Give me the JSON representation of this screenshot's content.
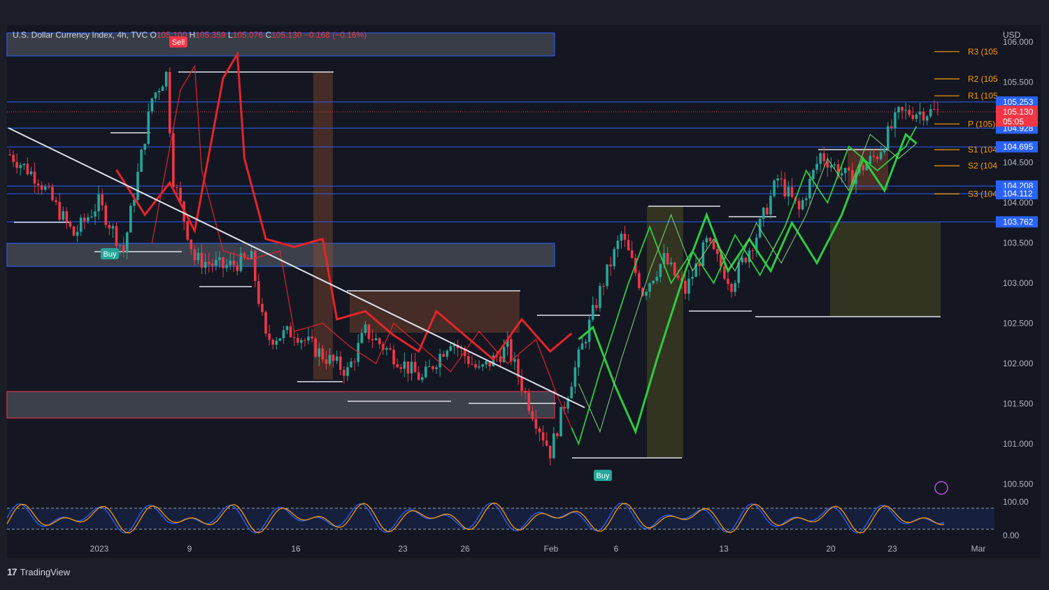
{
  "header": {
    "symbol": "U.S. Dollar Currency Index, 4h, TVC",
    "o_label": "O",
    "o_value": "105.100",
    "h_label": "H",
    "h_value": "105.359",
    "l_label": "L",
    "l_value": "105.076",
    "c_label": "C",
    "c_value": "105.130",
    "change": "−0.168 (−0.16%)"
  },
  "currency": "USD",
  "brand": "TradingView",
  "colors": {
    "up": "#26a69a",
    "down": "#f23645",
    "blue": "#2962ff",
    "pivot": "#ff9800",
    "green_ma": "#2ecc40",
    "red_ma": "#e5242a"
  },
  "chart_data": {
    "type": "candlestick",
    "title": "U.S. Dollar Currency Index, 4h, TVC",
    "ylim": [
      100.3,
      106.2
    ],
    "y_ticks": [
      "106.000",
      "105.500",
      "105.000",
      "104.500",
      "104.000",
      "103.500",
      "103.000",
      "102.500",
      "102.000",
      "101.500",
      "101.000",
      "100.500"
    ],
    "x_ticks": [
      "2023",
      "9",
      "16",
      "23",
      "26",
      "Feb",
      "6",
      "13",
      "20",
      "23",
      "Mar"
    ],
    "close_path": [
      [
        0,
        104.6
      ],
      [
        8,
        104.3
      ],
      [
        18,
        103.6
      ],
      [
        25,
        104.0
      ],
      [
        32,
        103.4
      ],
      [
        40,
        105.3
      ],
      [
        44,
        105.6
      ],
      [
        46,
        104.3
      ],
      [
        52,
        103.3
      ],
      [
        60,
        103.2
      ],
      [
        68,
        103.3
      ],
      [
        72,
        102.3
      ],
      [
        80,
        102.4
      ],
      [
        88,
        102.1
      ],
      [
        95,
        101.9
      ],
      [
        100,
        102.4
      ],
      [
        108,
        102.1
      ],
      [
        116,
        101.8
      ],
      [
        124,
        102.3
      ],
      [
        132,
        101.9
      ],
      [
        140,
        102.2
      ],
      [
        146,
        101.5
      ],
      [
        152,
        100.9
      ],
      [
        158,
        101.8
      ],
      [
        166,
        102.9
      ],
      [
        172,
        103.6
      ],
      [
        178,
        102.9
      ],
      [
        184,
        103.3
      ],
      [
        190,
        102.9
      ],
      [
        196,
        103.5
      ],
      [
        203,
        103.0
      ],
      [
        210,
        103.6
      ],
      [
        216,
        104.3
      ],
      [
        222,
        103.9
      ],
      [
        228,
        104.6
      ],
      [
        236,
        104.3
      ],
      [
        244,
        104.6
      ],
      [
        250,
        105.1
      ],
      [
        254,
        105.13
      ]
    ],
    "horizontal_levels": [
      "105.253",
      "104.928",
      "104.695",
      "104.208",
      "104.112",
      "103.762"
    ],
    "last_price": "105.130",
    "countdown": "05:05",
    "pivots": [
      {
        "label": "R3 (105",
        "value": 105.88
      },
      {
        "label": "R2 (105",
        "value": 105.54
      },
      {
        "label": "R1 (105",
        "value": 105.33
      },
      {
        "label": "P (105)",
        "value": 104.98
      },
      {
        "label": "S1 (104",
        "value": 104.66
      },
      {
        "label": "S2 (104",
        "value": 104.46
      },
      {
        "label": "S3 (104",
        "value": 104.11
      }
    ],
    "signals": [
      {
        "label": "Sell",
        "type": "sell",
        "date": "9"
      },
      {
        "label": "Buy",
        "type": "buy",
        "date": "2023"
      },
      {
        "label": "Buy",
        "type": "buy",
        "date": "Feb 3"
      }
    ],
    "oscillator": {
      "ticks": [
        "100.00",
        "0.00"
      ],
      "upper": 80,
      "lower": 20
    }
  }
}
